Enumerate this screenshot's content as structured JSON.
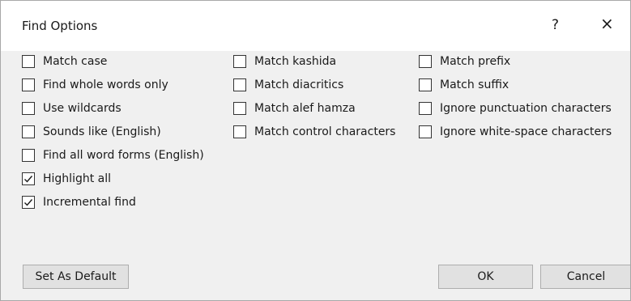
{
  "dialog": {
    "title": "Find Options",
    "help_glyph": "?",
    "close_glyph": "×"
  },
  "options": {
    "col1": [
      {
        "label": "Match case",
        "checked": false
      },
      {
        "label": "Find whole words only",
        "checked": false
      },
      {
        "label": "Use wildcards",
        "checked": false
      },
      {
        "label": "Sounds like (English)",
        "checked": false
      },
      {
        "label": "Find all word forms (English)",
        "checked": false
      },
      {
        "label": "Highlight all",
        "checked": true
      },
      {
        "label": "Incremental find",
        "checked": true
      }
    ],
    "col2": [
      {
        "label": "Match kashida",
        "checked": false
      },
      {
        "label": "Match diacritics",
        "checked": false
      },
      {
        "label": "Match alef hamza",
        "checked": false
      },
      {
        "label": "Match control characters",
        "checked": false
      }
    ],
    "col3": [
      {
        "label": "Match prefix",
        "checked": false
      },
      {
        "label": "Match suffix",
        "checked": false
      },
      {
        "label": "Ignore punctuation characters",
        "checked": false
      },
      {
        "label": "Ignore white-space characters",
        "checked": false
      }
    ]
  },
  "buttons": {
    "set_default": "Set As Default",
    "ok": "OK",
    "cancel": "Cancel"
  }
}
